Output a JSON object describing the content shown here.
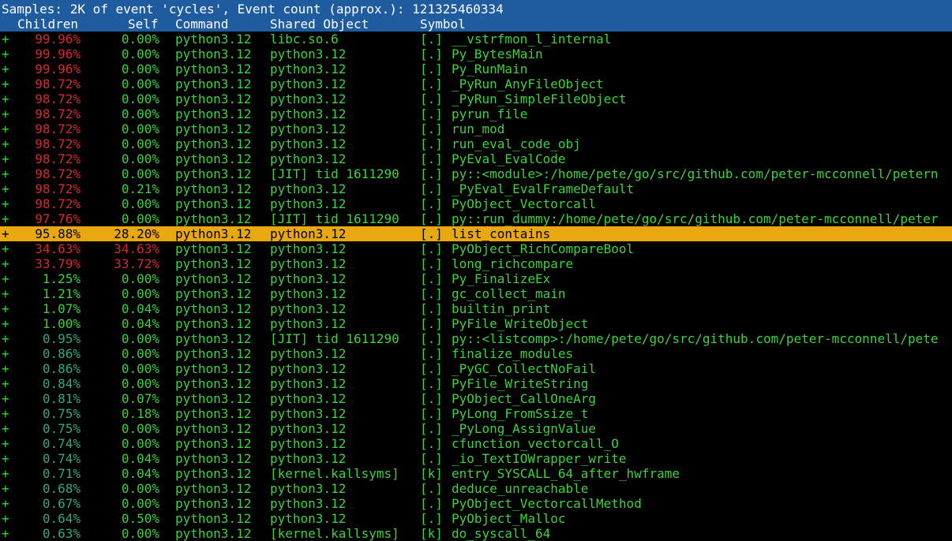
{
  "header": {
    "title": "Samples: 2K of event 'cycles', Event count (approx.): 121325460334",
    "columns": {
      "children": "Children",
      "self": "Self",
      "command": "Command",
      "shared_object": "Shared Object",
      "symbol": "Symbol"
    }
  },
  "colors": {
    "header_bg": "#1f5b9f",
    "hot": "#d62a2a",
    "normal": "#3cd23c",
    "cool": "#2fa97e",
    "selected_bg": "#e8a80e"
  },
  "rows": [
    {
      "plus": "+",
      "children": "99.96%",
      "self": "0.00%",
      "command": "python3.12",
      "shared": "libc.so.6",
      "marker": "[.]",
      "symbol": "__vstrfmon_l_internal",
      "children_class": "red",
      "self_class": "green"
    },
    {
      "plus": "+",
      "children": "99.96%",
      "self": "0.00%",
      "command": "python3.12",
      "shared": "python3.12",
      "marker": "[.]",
      "symbol": "Py_BytesMain",
      "children_class": "red",
      "self_class": "green"
    },
    {
      "plus": "+",
      "children": "99.96%",
      "self": "0.00%",
      "command": "python3.12",
      "shared": "python3.12",
      "marker": "[.]",
      "symbol": "Py_RunMain",
      "children_class": "red",
      "self_class": "green"
    },
    {
      "plus": "+",
      "children": "98.72%",
      "self": "0.00%",
      "command": "python3.12",
      "shared": "python3.12",
      "marker": "[.]",
      "symbol": "_PyRun_AnyFileObject",
      "children_class": "red",
      "self_class": "green"
    },
    {
      "plus": "+",
      "children": "98.72%",
      "self": "0.00%",
      "command": "python3.12",
      "shared": "python3.12",
      "marker": "[.]",
      "symbol": "_PyRun_SimpleFileObject",
      "children_class": "red",
      "self_class": "green"
    },
    {
      "plus": "+",
      "children": "98.72%",
      "self": "0.00%",
      "command": "python3.12",
      "shared": "python3.12",
      "marker": "[.]",
      "symbol": "pyrun_file",
      "children_class": "red",
      "self_class": "green"
    },
    {
      "plus": "+",
      "children": "98.72%",
      "self": "0.00%",
      "command": "python3.12",
      "shared": "python3.12",
      "marker": "[.]",
      "symbol": "run_mod",
      "children_class": "red",
      "self_class": "green"
    },
    {
      "plus": "+",
      "children": "98.72%",
      "self": "0.00%",
      "command": "python3.12",
      "shared": "python3.12",
      "marker": "[.]",
      "symbol": "run_eval_code_obj",
      "children_class": "red",
      "self_class": "green"
    },
    {
      "plus": "+",
      "children": "98.72%",
      "self": "0.00%",
      "command": "python3.12",
      "shared": "python3.12",
      "marker": "[.]",
      "symbol": "PyEval_EvalCode",
      "children_class": "red",
      "self_class": "green"
    },
    {
      "plus": "+",
      "children": "98.72%",
      "self": "0.00%",
      "command": "python3.12",
      "shared": "[JIT] tid 1611290",
      "marker": "[.]",
      "symbol": "py::<module>:/home/pete/go/src/github.com/peter-mcconnell/petern",
      "children_class": "red",
      "self_class": "green"
    },
    {
      "plus": "+",
      "children": "98.72%",
      "self": "0.21%",
      "command": "python3.12",
      "shared": "python3.12",
      "marker": "[.]",
      "symbol": "_PyEval_EvalFrameDefault",
      "children_class": "red",
      "self_class": "green"
    },
    {
      "plus": "+",
      "children": "98.72%",
      "self": "0.00%",
      "command": "python3.12",
      "shared": "python3.12",
      "marker": "[.]",
      "symbol": "PyObject_Vectorcall",
      "children_class": "red",
      "self_class": "green"
    },
    {
      "plus": "+",
      "children": "97.76%",
      "self": "0.00%",
      "command": "python3.12",
      "shared": "[JIT] tid 1611290",
      "marker": "[.]",
      "symbol": "py::run_dummy:/home/pete/go/src/github.com/peter-mcconnell/peter",
      "children_class": "red",
      "self_class": "green"
    },
    {
      "plus": "+",
      "children": "95.88%",
      "self": "28.20%",
      "command": "python3.12",
      "shared": "python3.12",
      "marker": "[.]",
      "symbol": "list_contains",
      "children_class": "red",
      "self_class": "red",
      "selected": true
    },
    {
      "plus": "+",
      "children": "34.63%",
      "self": "34.63%",
      "command": "python3.12",
      "shared": "python3.12",
      "marker": "[.]",
      "symbol": "PyObject_RichCompareBool",
      "children_class": "red",
      "self_class": "red"
    },
    {
      "plus": "+",
      "children": "33.79%",
      "self": "33.72%",
      "command": "python3.12",
      "shared": "python3.12",
      "marker": "[.]",
      "symbol": "long_richcompare",
      "children_class": "red",
      "self_class": "red"
    },
    {
      "plus": "+",
      "children": "1.25%",
      "self": "0.00%",
      "command": "python3.12",
      "shared": "python3.12",
      "marker": "[.]",
      "symbol": "Py_FinalizeEx",
      "children_class": "green",
      "self_class": "green"
    },
    {
      "plus": "+",
      "children": "1.21%",
      "self": "0.00%",
      "command": "python3.12",
      "shared": "python3.12",
      "marker": "[.]",
      "symbol": "gc_collect_main",
      "children_class": "green",
      "self_class": "green"
    },
    {
      "plus": "+",
      "children": "1.07%",
      "self": "0.04%",
      "command": "python3.12",
      "shared": "python3.12",
      "marker": "[.]",
      "symbol": "builtin_print",
      "children_class": "green",
      "self_class": "green"
    },
    {
      "plus": "+",
      "children": "1.00%",
      "self": "0.04%",
      "command": "python3.12",
      "shared": "python3.12",
      "marker": "[.]",
      "symbol": "PyFile_WriteObject",
      "children_class": "green",
      "self_class": "green"
    },
    {
      "plus": "+",
      "children": "0.95%",
      "self": "0.00%",
      "command": "python3.12",
      "shared": "[JIT] tid 1611290",
      "marker": "[.]",
      "symbol": "py::<listcomp>:/home/pete/go/src/github.com/peter-mcconnell/pete",
      "children_class": "dim",
      "self_class": "green"
    },
    {
      "plus": "+",
      "children": "0.86%",
      "self": "0.00%",
      "command": "python3.12",
      "shared": "python3.12",
      "marker": "[.]",
      "symbol": "finalize_modules",
      "children_class": "dim",
      "self_class": "green"
    },
    {
      "plus": "+",
      "children": "0.86%",
      "self": "0.00%",
      "command": "python3.12",
      "shared": "python3.12",
      "marker": "[.]",
      "symbol": "_PyGC_CollectNoFail",
      "children_class": "dim",
      "self_class": "green"
    },
    {
      "plus": "+",
      "children": "0.84%",
      "self": "0.00%",
      "command": "python3.12",
      "shared": "python3.12",
      "marker": "[.]",
      "symbol": "PyFile_WriteString",
      "children_class": "dim",
      "self_class": "green"
    },
    {
      "plus": "+",
      "children": "0.81%",
      "self": "0.07%",
      "command": "python3.12",
      "shared": "python3.12",
      "marker": "[.]",
      "symbol": "PyObject_CallOneArg",
      "children_class": "dim",
      "self_class": "green"
    },
    {
      "plus": "+",
      "children": "0.75%",
      "self": "0.18%",
      "command": "python3.12",
      "shared": "python3.12",
      "marker": "[.]",
      "symbol": "PyLong_FromSsize_t",
      "children_class": "dim",
      "self_class": "green"
    },
    {
      "plus": "+",
      "children": "0.75%",
      "self": "0.00%",
      "command": "python3.12",
      "shared": "python3.12",
      "marker": "[.]",
      "symbol": "_PyLong_AssignValue",
      "children_class": "dim",
      "self_class": "green"
    },
    {
      "plus": "+",
      "children": "0.74%",
      "self": "0.00%",
      "command": "python3.12",
      "shared": "python3.12",
      "marker": "[.]",
      "symbol": "cfunction_vectorcall_O",
      "children_class": "dim",
      "self_class": "green"
    },
    {
      "plus": "+",
      "children": "0.74%",
      "self": "0.04%",
      "command": "python3.12",
      "shared": "python3.12",
      "marker": "[.]",
      "symbol": "_io_TextIOWrapper_write",
      "children_class": "dim",
      "self_class": "green"
    },
    {
      "plus": "+",
      "children": "0.71%",
      "self": "0.04%",
      "command": "python3.12",
      "shared": "[kernel.kallsyms]",
      "marker": "[k]",
      "symbol": "entry_SYSCALL_64_after_hwframe",
      "children_class": "dim",
      "self_class": "green"
    },
    {
      "plus": "+",
      "children": "0.68%",
      "self": "0.00%",
      "command": "python3.12",
      "shared": "python3.12",
      "marker": "[.]",
      "symbol": "deduce_unreachable",
      "children_class": "dim",
      "self_class": "green"
    },
    {
      "plus": "+",
      "children": "0.67%",
      "self": "0.00%",
      "command": "python3.12",
      "shared": "python3.12",
      "marker": "[.]",
      "symbol": "PyObject_VectorcallMethod",
      "children_class": "dim",
      "self_class": "green"
    },
    {
      "plus": "+",
      "children": "0.64%",
      "self": "0.50%",
      "command": "python3.12",
      "shared": "python3.12",
      "marker": "[.]",
      "symbol": "PyObject_Malloc",
      "children_class": "dim",
      "self_class": "green"
    },
    {
      "plus": "+",
      "children": "0.63%",
      "self": "0.00%",
      "command": "python3.12",
      "shared": "[kernel.kallsyms]",
      "marker": "[k]",
      "symbol": "do_syscall_64",
      "children_class": "dim",
      "self_class": "green"
    }
  ]
}
